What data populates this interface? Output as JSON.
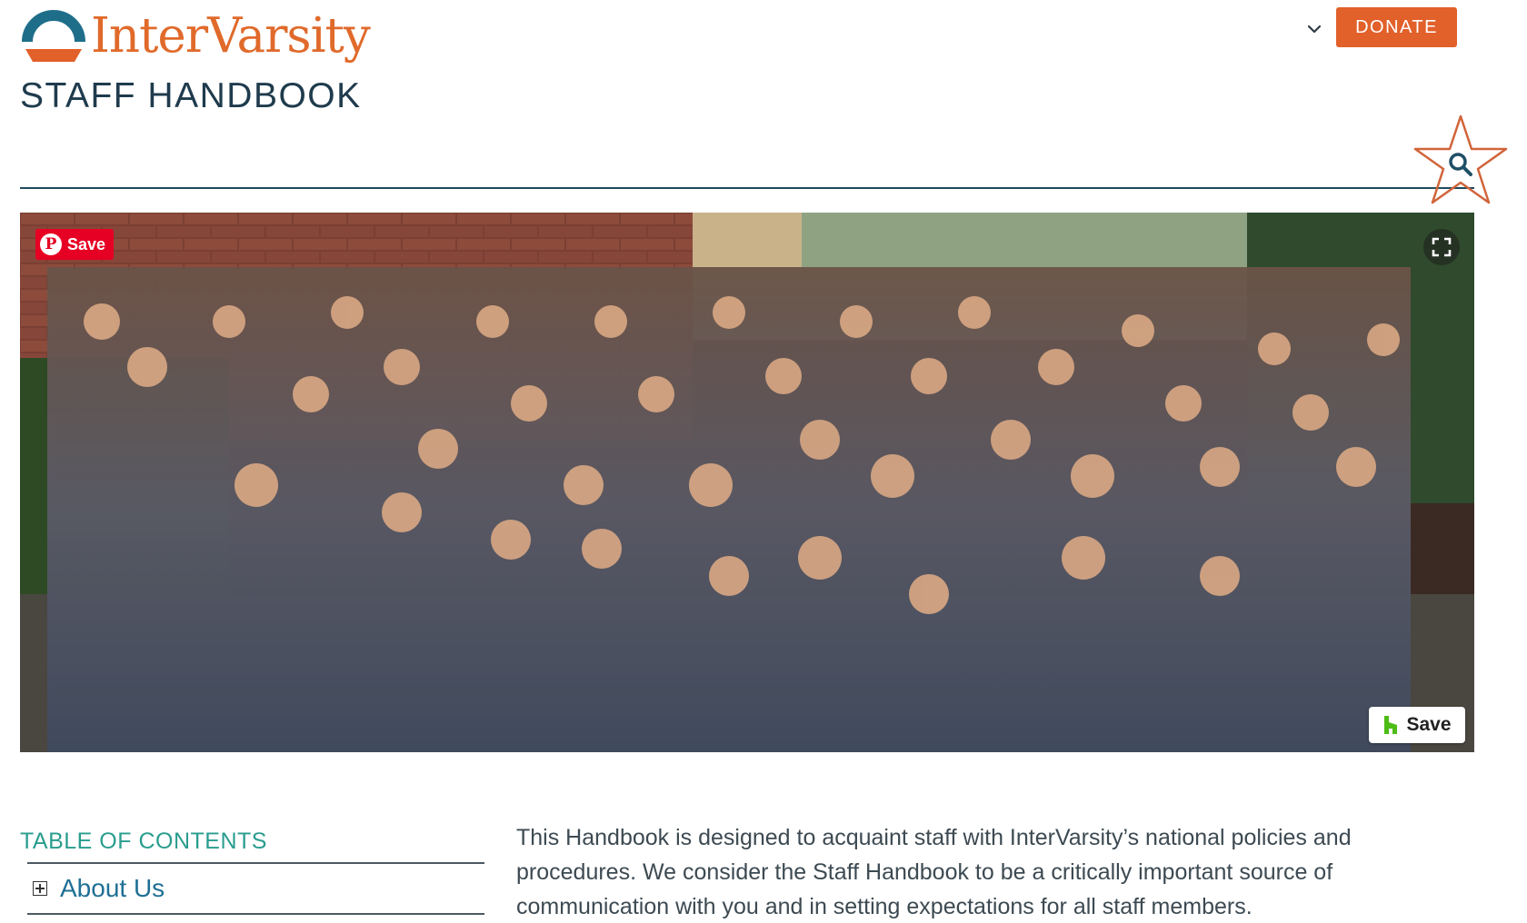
{
  "header": {
    "brand": "InterVarsity",
    "title": "STAFF HANDBOOK",
    "donate_label": "DONATE",
    "colors": {
      "brand_orange": "#e2602a",
      "brand_teal": "#1e6e8a",
      "title_navy": "#1f3b4d"
    }
  },
  "search": {
    "icon": "search-icon"
  },
  "hero": {
    "pinterest_save_label": "Save",
    "houzz_save_label": "Save",
    "fullscreen_icon": "expand-icon"
  },
  "toc": {
    "heading": "TABLE OF CONTENTS",
    "items": [
      {
        "label": "About Us"
      }
    ]
  },
  "intro": {
    "text": "This Handbook is designed to acquaint staff with InterVarsity’s national policies and procedures.  We consider the Staff Handbook to be a critically important source of communication with you and in setting expectations for all staff members."
  }
}
